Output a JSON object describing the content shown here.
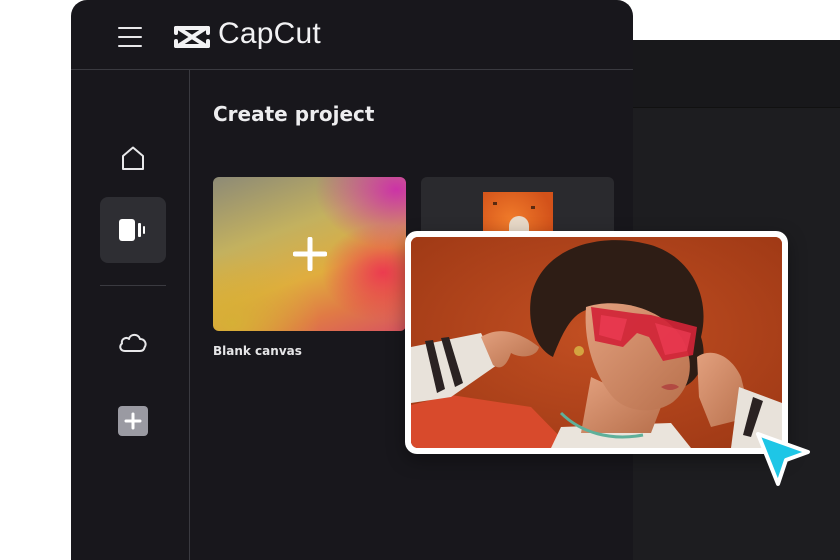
{
  "app": {
    "name": "CapCut"
  },
  "content": {
    "title": "Create project",
    "cards": [
      {
        "label": "Blank canvas",
        "icon": "plus-icon"
      }
    ]
  },
  "sidebar": {
    "items": [
      {
        "name": "home",
        "icon": "home-icon",
        "active": false
      },
      {
        "name": "projects",
        "icon": "video-icon",
        "active": true
      },
      {
        "name": "cloud",
        "icon": "cloud-icon",
        "active": false
      },
      {
        "name": "add",
        "icon": "plus-square-icon",
        "active": false
      }
    ]
  },
  "colors": {
    "window_bg": "#18171c",
    "active_item": "#2e2e33",
    "cursor": "#1ec6e6",
    "text": "#ededef"
  }
}
